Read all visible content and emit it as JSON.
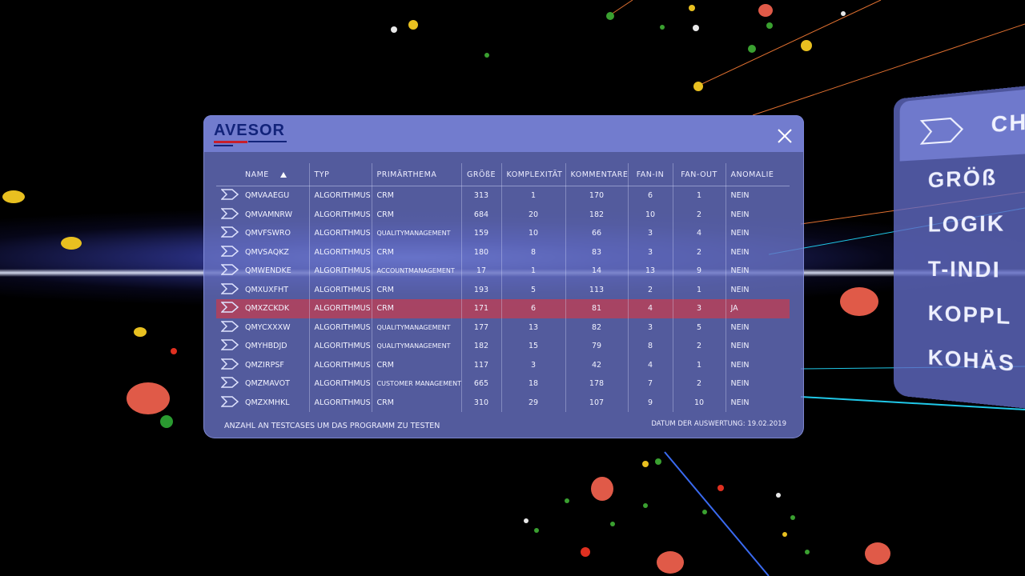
{
  "app": {
    "logo": "AVESOR"
  },
  "table": {
    "columns": {
      "name": "NAME",
      "typ": "TYP",
      "thema": "PRIMÄRTHEMA",
      "groesse": "GRÖßE",
      "komplexitaet": "KOMPLEXITÄT",
      "kommentare": "KOMMENTARE",
      "fanin": "FAN-IN",
      "fanout": "FAN-OUT",
      "anomalie": "ANOMALIE"
    },
    "rows": [
      {
        "name": "QMVAAEGU",
        "typ": "ALGORITHMUS",
        "thema": "CRM",
        "groesse": "313",
        "komplexitaet": "1",
        "kommentare": "170",
        "fanin": "6",
        "fanout": "1",
        "anomalie": "NEIN"
      },
      {
        "name": "QMVAMNRW",
        "typ": "ALGORITHMUS",
        "thema": "CRM",
        "groesse": "684",
        "komplexitaet": "20",
        "kommentare": "182",
        "fanin": "10",
        "fanout": "2",
        "anomalie": "NEIN"
      },
      {
        "name": "QMVFSWRO",
        "typ": "ALGORITHMUS",
        "thema": "QUALITYMANAGEMENT",
        "groesse": "159",
        "komplexitaet": "10",
        "kommentare": "66",
        "fanin": "3",
        "fanout": "4",
        "anomalie": "NEIN"
      },
      {
        "name": "QMVSAQKZ",
        "typ": "ALGORITHMUS",
        "thema": "CRM",
        "groesse": "180",
        "komplexitaet": "8",
        "kommentare": "83",
        "fanin": "3",
        "fanout": "2",
        "anomalie": "NEIN"
      },
      {
        "name": "QMWENDKE",
        "typ": "ALGORITHMUS",
        "thema": "ACCOUNTMANAGEMENT",
        "groesse": "17",
        "komplexitaet": "1",
        "kommentare": "14",
        "fanin": "13",
        "fanout": "9",
        "anomalie": "NEIN"
      },
      {
        "name": "QMXUXFHT",
        "typ": "ALGORITHMUS",
        "thema": "CRM",
        "groesse": "193",
        "komplexitaet": "5",
        "kommentare": "113",
        "fanin": "2",
        "fanout": "1",
        "anomalie": "NEIN"
      },
      {
        "name": "QMXZCKDK",
        "typ": "ALGORITHMUS",
        "thema": "CRM",
        "groesse": "171",
        "komplexitaet": "6",
        "kommentare": "81",
        "fanin": "4",
        "fanout": "3",
        "anomalie": "JA"
      },
      {
        "name": "QMYCXXXW",
        "typ": "ALGORITHMUS",
        "thema": "QUALITYMANAGEMENT",
        "groesse": "177",
        "komplexitaet": "13",
        "kommentare": "82",
        "fanin": "3",
        "fanout": "5",
        "anomalie": "NEIN"
      },
      {
        "name": "QMYHBDJD",
        "typ": "ALGORITHMUS",
        "thema": "QUALITYMANAGEMENT",
        "groesse": "182",
        "komplexitaet": "15",
        "kommentare": "79",
        "fanin": "8",
        "fanout": "2",
        "anomalie": "NEIN"
      },
      {
        "name": "QMZIRPSF",
        "typ": "ALGORITHMUS",
        "thema": "CRM",
        "groesse": "117",
        "komplexitaet": "3",
        "kommentare": "42",
        "fanin": "4",
        "fanout": "1",
        "anomalie": "NEIN"
      },
      {
        "name": "QMZMAVOT",
        "typ": "ALGORITHMUS",
        "thema": "CUSTOMER MANAGEMENT",
        "groesse": "665",
        "komplexitaet": "18",
        "kommentare": "178",
        "fanin": "7",
        "fanout": "2",
        "anomalie": "NEIN"
      },
      {
        "name": "QMZXMHKL",
        "typ": "ALGORITHMUS",
        "thema": "CRM",
        "groesse": "310",
        "komplexitaet": "29",
        "kommentare": "107",
        "fanin": "9",
        "fanout": "10",
        "anomalie": "NEIN"
      }
    ]
  },
  "footer": {
    "left": "ANZAHL AN TESTCASES UM DAS PROGRAMM ZU TESTEN",
    "right": "DATUM DER AUSWERTUNG: 19.02.2019"
  },
  "side_panel": {
    "title": "CH",
    "items": [
      "GRÖß",
      "LOGIK",
      "T-INDI",
      "KOPPL",
      "KOHÄS"
    ]
  },
  "colors": {
    "panel": "#6872c4",
    "highlight_row": "#c33c50",
    "logo": "#12237a",
    "logo_accent": "#c81e2a"
  },
  "icons": {
    "close": "close-icon",
    "row": "chevron-right-icon",
    "sort": "sort-ascending-icon"
  }
}
